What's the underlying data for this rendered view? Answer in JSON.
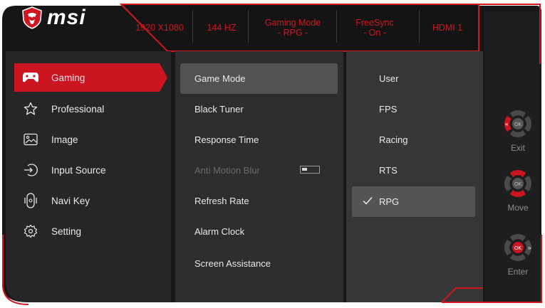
{
  "brand": {
    "logo_text": "msi",
    "logo_icon": "dragon-shield-icon"
  },
  "status_bar": {
    "resolution": "1920 X1080",
    "refresh": "144 HZ",
    "game_mode_line1": "Gaming Mode",
    "game_mode_line2": "- RPG -",
    "freesync_line1": "FreeSync",
    "freesync_line2": "- On -",
    "input": "HDMI 1"
  },
  "main_menu": {
    "items": [
      {
        "label": "Gaming",
        "icon": "gamepad-icon",
        "selected": true
      },
      {
        "label": "Professional",
        "icon": "star-icon"
      },
      {
        "label": "Image",
        "icon": "image-icon"
      },
      {
        "label": "Input Source",
        "icon": "input-source-icon"
      },
      {
        "label": "Navi Key",
        "icon": "joystick-icon"
      },
      {
        "label": "Setting",
        "icon": "gear-icon"
      }
    ]
  },
  "sub_menu": {
    "items": [
      {
        "label": "Game Mode",
        "selected": true
      },
      {
        "label": "Black Tuner"
      },
      {
        "label": "Response Time"
      },
      {
        "label": "Anti Motion Blur",
        "disabled": true,
        "toggle": "off"
      },
      {
        "label": "Refresh Rate"
      },
      {
        "label": "Alarm Clock"
      },
      {
        "label": "Screen Assistance"
      }
    ]
  },
  "options": {
    "items": [
      {
        "label": "User"
      },
      {
        "label": "FPS"
      },
      {
        "label": "Racing"
      },
      {
        "label": "RTS"
      },
      {
        "label": "RPG",
        "checked": true
      }
    ]
  },
  "navigation": {
    "exit_label": "Exit",
    "move_label": "Move",
    "enter_label": "Enter",
    "ok_text": "OK"
  },
  "colors": {
    "accent_red": "#d01620",
    "panel_dark": "#1b1b1b",
    "panel_mid": "#2e2e2e",
    "panel_light": "#373737",
    "selected_gray": "#505050"
  }
}
